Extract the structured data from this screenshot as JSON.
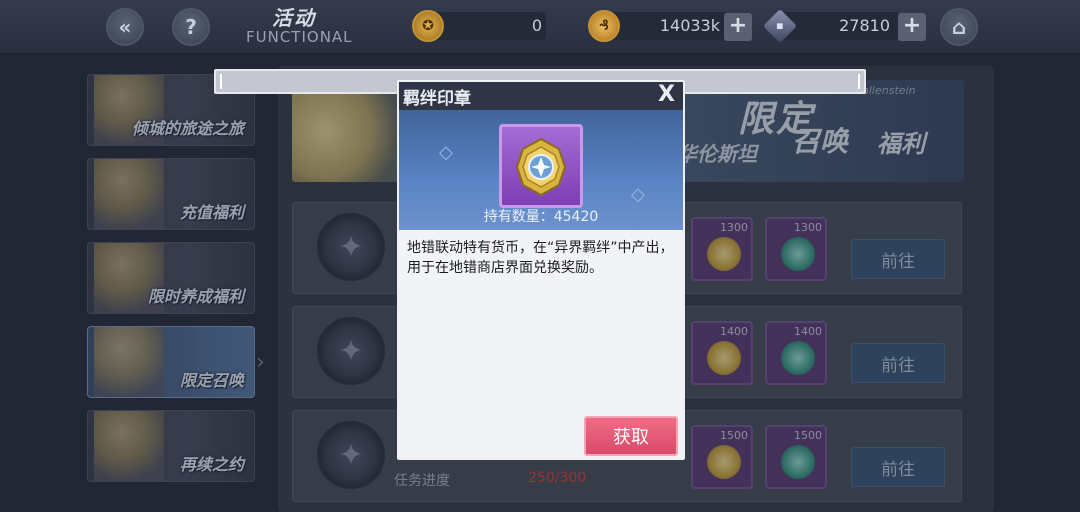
{
  "header": {
    "title_cn": "活动",
    "title_en": "FUNCTIONAL",
    "back_icon": "chevrons-left-icon",
    "help_icon": "question-icon",
    "home_icon": "home-icon"
  },
  "resources": [
    {
      "icon": "gold-coin-icon",
      "value": "0"
    },
    {
      "icon": "ticket-coin-icon",
      "value": "14033k"
    },
    {
      "icon": "crystal-cube-icon",
      "value": "27810"
    }
  ],
  "plus_label": "+",
  "sidebar": {
    "items": [
      {
        "label": "倾城的旅途之旅"
      },
      {
        "label": "充值福利"
      },
      {
        "label": "限时养成福利"
      },
      {
        "label": "限定召唤"
      },
      {
        "label": "再续之约"
      }
    ],
    "arrow": "›"
  },
  "banner": {
    "title1": "限定",
    "title2": "召唤",
    "title3": "福利",
    "subtitle": "华伦斯坦",
    "en": "Aiz Wallenstein"
  },
  "tasks": [
    {
      "rewards": [
        {
          "qty": "1300"
        },
        {
          "qty": "1300"
        }
      ],
      "button": "前往"
    },
    {
      "rewards": [
        {
          "qty": "1400"
        },
        {
          "qty": "1400"
        }
      ],
      "button": "前往"
    },
    {
      "rewards": [
        {
          "qty": "1500"
        },
        {
          "qty": "1500"
        }
      ],
      "button": "前往"
    }
  ],
  "progress": {
    "label": "任务进度",
    "value": "250/300"
  },
  "popup": {
    "title": "羁绊印章",
    "close": "X",
    "count_text": "持有数量：45420",
    "description": "地错联动特有货币，在“异界羁绊”中产出，用于在地错商店界面兑换奖励。",
    "obtain_button": "获取"
  }
}
